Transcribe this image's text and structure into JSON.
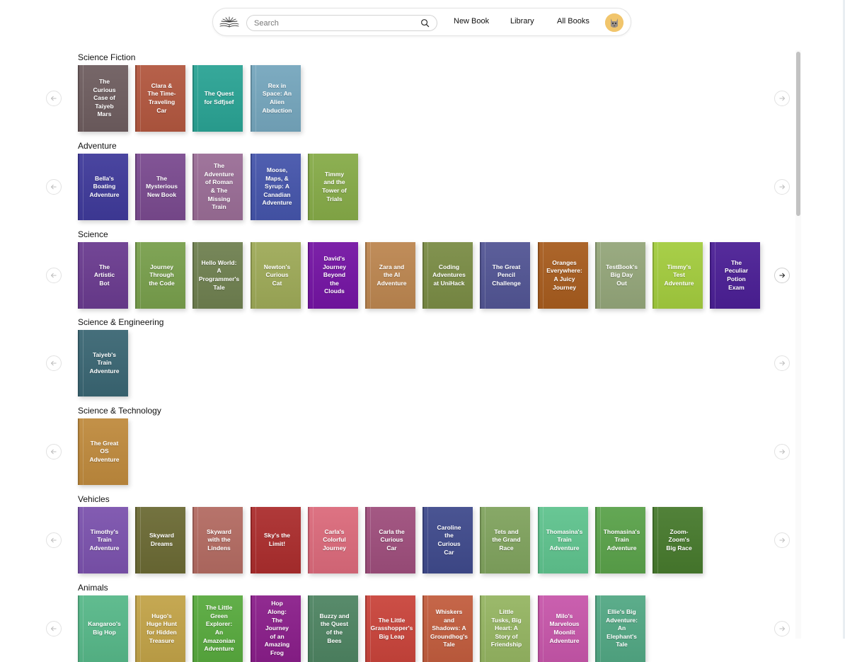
{
  "nav": {
    "search_placeholder": "Search",
    "links": [
      "New Book",
      "Library",
      "All Books"
    ]
  },
  "sections": [
    {
      "title": "Science Fiction",
      "books": [
        {
          "title": "The Curious Case of Taiyeb Mars",
          "color": "#6e5d5f"
        },
        {
          "title": "Clara & The Time-Traveling Car",
          "color": "#b2573f"
        },
        {
          "title": "The Quest for Sdfjsef",
          "color": "#2aa394"
        },
        {
          "title": "Rex in Space: An Alien Abduction",
          "color": "#75a6bd"
        }
      ],
      "right_active": false
    },
    {
      "title": "Adventure",
      "books": [
        {
          "title": "Bella's Boating Adventure",
          "color": "#3f3a9a"
        },
        {
          "title": "The Mysterious New Book",
          "color": "#7a4a8f"
        },
        {
          "title": "The Adventure of Roman & The Missing Train",
          "color": "#9a6d96"
        },
        {
          "title": "Moose, Maps, & Syrup: A Canadian Adventure",
          "color": "#4555ab"
        },
        {
          "title": "Timmy and the Tower of Trials",
          "color": "#86ab48"
        }
      ],
      "right_active": false
    },
    {
      "title": "Science",
      "books": [
        {
          "title": "The Artistic Bot",
          "color": "#6a3b8f"
        },
        {
          "title": "Journey Through the Code",
          "color": "#789f4c"
        },
        {
          "title": "Hello World: A Programmer's Tale",
          "color": "#6f8050"
        },
        {
          "title": "Newton's Curious Cat",
          "color": "#9eaa58"
        },
        {
          "title": "David's Journey Beyond the Clouds",
          "color": "#7414a3"
        },
        {
          "title": "Zara and the AI Adventure",
          "color": "#bc8650"
        },
        {
          "title": "Coding Adventures at UniHack",
          "color": "#7a8c45"
        },
        {
          "title": "The Great Pencil Challenge",
          "color": "#525594"
        },
        {
          "title": "Oranges Everywhere: A Juicy Journey",
          "color": "#a75c1e"
        },
        {
          "title": "TestBook's Big Day Out",
          "color": "#94a67a"
        },
        {
          "title": "Timmy's Test Adventure",
          "color": "#a3cc3e"
        },
        {
          "title": "The Peculiar Potion Exam",
          "color": "#4b1f95"
        }
      ],
      "right_active": true
    },
    {
      "title": "Science & Engineering",
      "books": [
        {
          "title": "Taiyeb's Train Adventure",
          "color": "#3a6673"
        }
      ],
      "right_active": false
    },
    {
      "title": "Science & Technology",
      "books": [
        {
          "title": "The Great OS Adventure",
          "color": "#bf8a3d"
        }
      ],
      "right_active": false
    },
    {
      "title": "Vehicles",
      "books": [
        {
          "title": "Timothy's Train Adventure",
          "color": "#7b52ad"
        },
        {
          "title": "Skyward Dreams",
          "color": "#6b6a34"
        },
        {
          "title": "Skyward with the Lindens",
          "color": "#b36b62"
        },
        {
          "title": "Sky's the Limit!",
          "color": "#ab2d2d"
        },
        {
          "title": "Carla's Colorful Journey",
          "color": "#db6a7b"
        },
        {
          "title": "Carla the Curious Car",
          "color": "#9e4e7c"
        },
        {
          "title": "Caroline the Curious Car",
          "color": "#3f4a8c"
        },
        {
          "title": "Tets and the Grand Race",
          "color": "#80a35e"
        },
        {
          "title": "Thomasina's Train Adventure",
          "color": "#5fc38e"
        },
        {
          "title": "Thomasina's Train Adventure",
          "color": "#5aa24a"
        },
        {
          "title": "Zoom-Zoom's Big Race",
          "color": "#477a2d"
        }
      ],
      "right_active": false
    },
    {
      "title": "Animals",
      "books": [
        {
          "title": "Kangaroo's Big Hop",
          "color": "#57b889"
        },
        {
          "title": "Hugo's Huge Hunt for Hidden Treasure",
          "color": "#c2a348"
        },
        {
          "title": "The Little Green Explorer: An Amazonian Adventure",
          "color": "#58aa3e"
        },
        {
          "title": "Hop Along: The Journey of an Amazing Frog",
          "color": "#8a1e8a"
        },
        {
          "title": "Buzzy and the Quest of the Bees",
          "color": "#4e8462"
        },
        {
          "title": "The Little Grasshopper's Big Leap",
          "color": "#c9443b"
        },
        {
          "title": "Whiskers and Shadows: A Groundhog's Tale",
          "color": "#c25d3e"
        },
        {
          "title": "Little Tusks, Big Heart: A Story of Friendship",
          "color": "#95b562"
        },
        {
          "title": "Milo's Marvelous Moonlit Adventure",
          "color": "#c756aa"
        },
        {
          "title": "Ellie's Big Adventure: An Elephant's Tale",
          "color": "#52a884"
        }
      ],
      "right_active": false
    }
  ]
}
